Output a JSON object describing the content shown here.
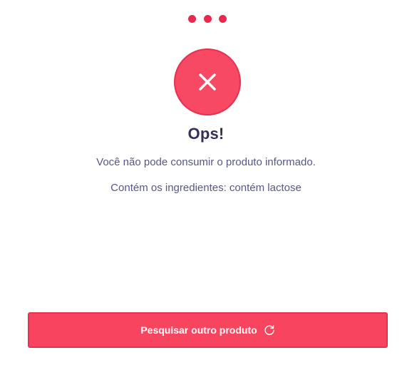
{
  "header": {
    "menu_icon": "more-horizontal-icon"
  },
  "status": {
    "icon": "close-icon",
    "title": "Ops!",
    "message": "Você não pode consumir o produto informado.",
    "ingredients_text": "Contém os ingredientes: contém lactose"
  },
  "action": {
    "label": "Pesquisar outro produto",
    "icon": "refresh-icon"
  },
  "colors": {
    "accent": "#f7455f",
    "accent_border": "#e5304f",
    "title": "#34305a",
    "text": "#57568a",
    "background": "#ffffff"
  }
}
